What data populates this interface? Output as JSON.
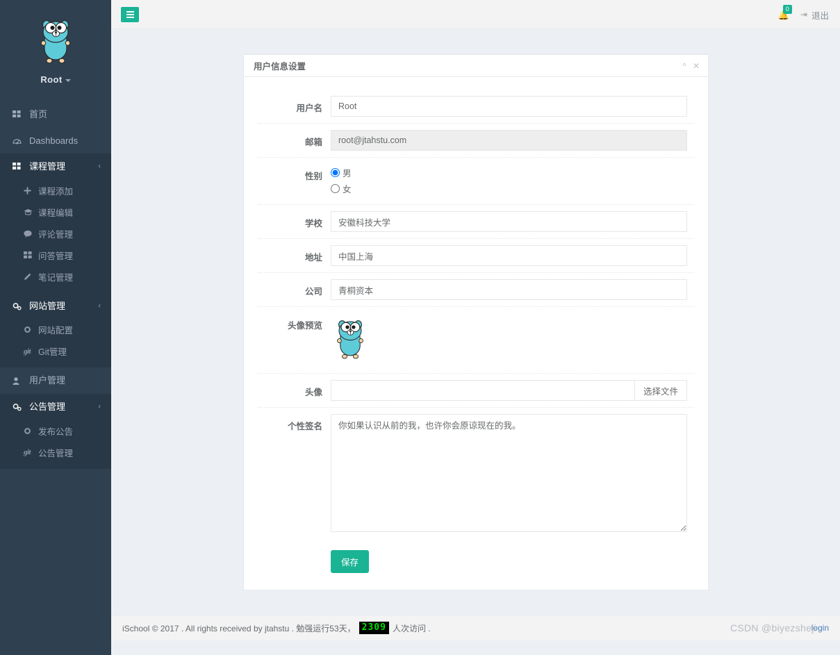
{
  "sidebar": {
    "brand": {
      "name": "Root",
      "logo_icon": "go-gopher-logo",
      "caret_icon": "caret-down-icon"
    },
    "items": [
      {
        "label": "首页",
        "icon": "grid-icon",
        "expandable": false,
        "open": false,
        "children": []
      },
      {
        "label": "Dashboards",
        "icon": "dashboard-icon",
        "expandable": false,
        "open": false,
        "children": []
      },
      {
        "label": "课程管理",
        "icon": "grid-icon",
        "expandable": true,
        "open": true,
        "arrow_icon": "chevron-left-icon",
        "children": [
          {
            "label": "课程添加",
            "icon": "plus-icon"
          },
          {
            "label": "课程编辑",
            "icon": "graduation-cap-icon"
          },
          {
            "label": "评论管理",
            "icon": "comment-icon"
          },
          {
            "label": "问答管理",
            "icon": "grid-icon"
          },
          {
            "label": "笔记管理",
            "icon": "pencil-icon"
          }
        ]
      },
      {
        "label": "网站管理",
        "icon": "gears-icon",
        "expandable": true,
        "open": true,
        "arrow_icon": "chevron-left-icon",
        "children": [
          {
            "label": "网站配置",
            "icon": "gear-icon"
          },
          {
            "label": "Git管理",
            "icon": "git-icon"
          }
        ]
      },
      {
        "label": "用户管理",
        "icon": "user-icon",
        "expandable": false,
        "open": false,
        "children": []
      },
      {
        "label": "公告管理",
        "icon": "gears-icon",
        "expandable": true,
        "open": true,
        "arrow_icon": "chevron-left-icon",
        "children": [
          {
            "label": "发布公告",
            "icon": "gear-icon"
          },
          {
            "label": "公告管理",
            "icon": "git-icon"
          }
        ]
      }
    ]
  },
  "topbar": {
    "menu_toggle_icon": "hamburger-icon",
    "bell_icon": "bell-icon",
    "notification_count": "0",
    "logout_icon": "sign-out-icon",
    "logout_label": "退出"
  },
  "panel": {
    "title": "用户信息设置",
    "collapse_icon": "chevron-up-icon",
    "close_icon": "close-icon"
  },
  "form": {
    "username": {
      "label": "用户名",
      "value": "Root",
      "placeholder": ""
    },
    "email": {
      "label": "邮箱",
      "value": "root@jtahstu.com",
      "placeholder": "",
      "disabled": true
    },
    "gender": {
      "label": "性别",
      "options": [
        {
          "label": "男",
          "checked": true
        },
        {
          "label": "女",
          "checked": false
        }
      ]
    },
    "school": {
      "label": "学校",
      "value": "安徽科技大学",
      "placeholder": ""
    },
    "address": {
      "label": "地址",
      "value": "中国上海",
      "placeholder": ""
    },
    "company": {
      "label": "公司",
      "value": "青桐资本",
      "placeholder": ""
    },
    "avatar_preview": {
      "label": "头像预览",
      "image_icon": "go-gopher-avatar"
    },
    "avatar_upload": {
      "label": "头像",
      "value": "",
      "placeholder": "",
      "button_label": "选择文件"
    },
    "signature": {
      "label": "个性签名",
      "value": "你如果认识从前的我，也许你会原谅现在的我。",
      "placeholder": ""
    },
    "save_button": "保存"
  },
  "footer": {
    "text_before": "iSchool © 2017 . All rights received by jtahstu . 勉强运行53天，",
    "counter": "2309",
    "text_after": "人次访问 .",
    "login_label": "login"
  },
  "watermark": {
    "text": "CSDN @biyezsheji"
  },
  "colors": {
    "accent": "#1ab394",
    "sidebar_bg": "#2f4050",
    "sidebar_sub_bg": "#293846",
    "page_bg": "#ecf0f5",
    "counter_green": "#00e000",
    "radio_blue": "#2196f3"
  }
}
